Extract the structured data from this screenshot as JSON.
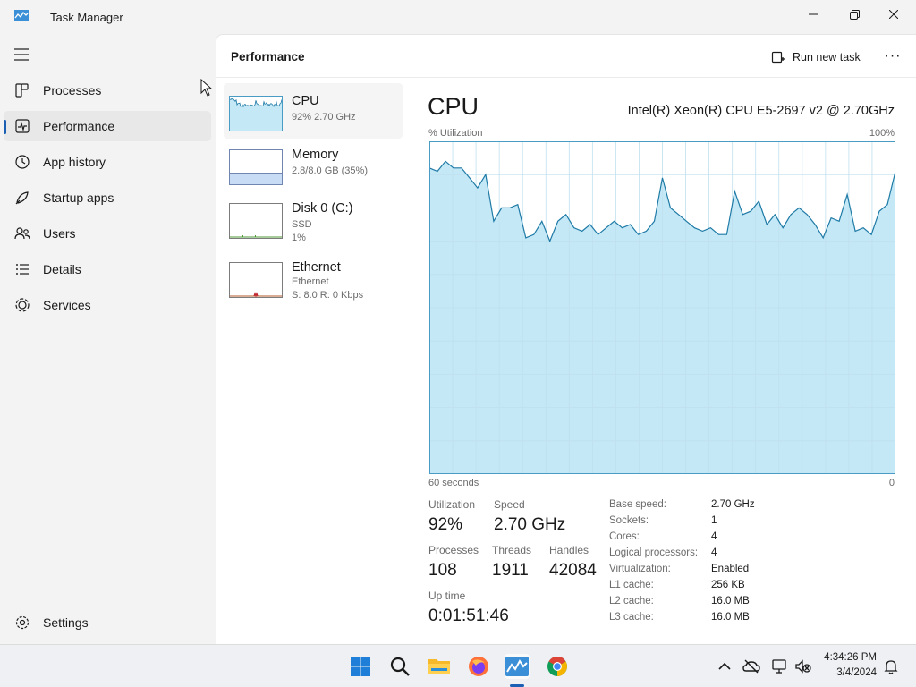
{
  "window": {
    "title": "Task Manager"
  },
  "nav": {
    "items": [
      {
        "label": "Processes",
        "icon": "processes-icon"
      },
      {
        "label": "Performance",
        "icon": "performance-icon",
        "active": true
      },
      {
        "label": "App history",
        "icon": "app-history-icon"
      },
      {
        "label": "Startup apps",
        "icon": "startup-icon"
      },
      {
        "label": "Users",
        "icon": "users-icon"
      },
      {
        "label": "Details",
        "icon": "details-icon"
      },
      {
        "label": "Services",
        "icon": "services-icon"
      }
    ],
    "settings_label": "Settings"
  },
  "header": {
    "title": "Performance",
    "run_task_label": "Run new task",
    "more_label": "···"
  },
  "resources": [
    {
      "name": "CPU",
      "line1": "92%  2.70 GHz",
      "line2": ""
    },
    {
      "name": "Memory",
      "line1": "2.8/8.0 GB (35%)",
      "line2": ""
    },
    {
      "name": "Disk 0 (C:)",
      "line1": "SSD",
      "line2": "1%"
    },
    {
      "name": "Ethernet",
      "line1": "Ethernet",
      "line2": "S: 8.0  R: 0 Kbps"
    }
  ],
  "cpu": {
    "title": "CPU",
    "model": "Intel(R) Xeon(R) CPU E5-2697 v2 @ 2.70GHz",
    "util_label": "% Utilization",
    "util_max": "100%",
    "time_label": "60 seconds",
    "time_min": "0",
    "stats": {
      "utilization_label": "Utilization",
      "utilization_value": "92%",
      "speed_label": "Speed",
      "speed_value": "2.70 GHz",
      "processes_label": "Processes",
      "processes_value": "108",
      "threads_label": "Threads",
      "threads_value": "1911",
      "handles_label": "Handles",
      "handles_value": "42084",
      "uptime_label": "Up time",
      "uptime_value": "0:01:51:46"
    },
    "specs": [
      {
        "label": "Base speed:",
        "value": "2.70 GHz"
      },
      {
        "label": "Sockets:",
        "value": "1"
      },
      {
        "label": "Cores:",
        "value": "4"
      },
      {
        "label": "Logical processors:",
        "value": "4"
      },
      {
        "label": "Virtualization:",
        "value": "Enabled"
      },
      {
        "label": "L1 cache:",
        "value": "256 KB"
      },
      {
        "label": "L2 cache:",
        "value": "16.0 MB"
      },
      {
        "label": "L3 cache:",
        "value": "16.0 MB"
      }
    ],
    "history_pct": [
      92,
      91,
      94,
      92,
      92,
      89,
      86,
      90,
      76,
      80,
      80,
      81,
      71,
      72,
      76,
      70,
      76,
      78,
      74,
      73,
      75,
      72,
      74,
      76,
      74,
      75,
      72,
      73,
      76,
      89,
      80,
      78,
      76,
      74,
      73,
      74,
      72,
      72,
      85,
      78,
      79,
      82,
      75,
      78,
      74,
      78,
      80,
      78,
      75,
      71,
      77,
      76,
      84,
      73,
      74,
      72,
      79,
      81,
      91
    ]
  },
  "colors": {
    "accent": "#1a5fb4",
    "graph_fill": "#c4e8f6",
    "graph_line": "#1e7aa6",
    "graph_grid": "#bfe0ee",
    "graph_border": "#4a9cc4"
  },
  "taskbar": {
    "apps": [
      "windows-start-icon",
      "search-icon",
      "file-explorer-icon",
      "firefox-icon",
      "task-manager-icon",
      "chrome-icon"
    ],
    "clock_time": "4:34:26 PM",
    "clock_date": "3/4/2024"
  }
}
